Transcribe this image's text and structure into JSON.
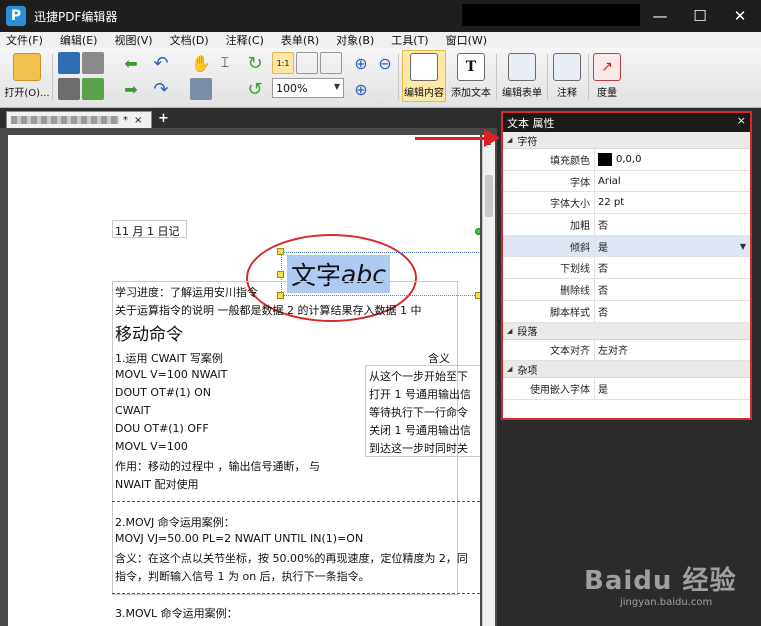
{
  "window": {
    "title": "迅捷PDF编辑器",
    "logo_text": "P",
    "controls": {
      "minimize": "—",
      "maximize": "☐",
      "close": "✕"
    }
  },
  "menu": [
    "文件(F)",
    "编辑(E)",
    "视图(V)",
    "文档(D)",
    "注释(C)",
    "表单(R)",
    "对象(B)",
    "工具(T)",
    "窗口(W)"
  ],
  "toolbar": {
    "open_label": "打开(O)...",
    "zoom_value": "100%",
    "edit_content_label": "编辑内容",
    "add_text_label": "添加文本",
    "edit_form_label": "编辑表单",
    "annotate_label": "注释",
    "measure_label": "度量",
    "actual_size_icon_text": "1:1"
  },
  "document_tab": {
    "modified_marker": "*",
    "close": "×",
    "new_tab": "+"
  },
  "page": {
    "date_label": "11 月 1  日记",
    "selected_text_cn": "文字",
    "selected_text_en": "abc",
    "lines": [
      "学习进度：了解运用安川指令",
      "关于运算指令的说明  一般都是数据 2  的计算结果存入数据 1 中",
      "移动命令",
      "1.运用 CWAIT  写案例",
      "含义",
      "MOVL V=100 NWAIT",
      "DOUT OT#(1) ON",
      "CWAIT",
      "DOU OT#(1) OFF",
      "MOVL V=100",
      "作用：移动的过程中 ，输出信号通断， 与",
      "NWAIT 配对使用",
      "从这个一步开始至下",
      "打开 1 号通用输出信",
      "等待执行下一行命令",
      "关闭 1 号通用输出信",
      "到达这一步时同时关",
      "2.MOVJ 命令运用案例：",
      "MOVJ    VJ=50.00    PL=2    NWAIT    UNTIL    IN(1)=ON",
      "含义：在这个点以关节坐标，按 50.00%的再现速度，定位精度为 2，同",
      "指令，判断输入信号 1 为 on 后，执行下一条指令。",
      "3.MOVL 命令运用案例："
    ]
  },
  "properties": {
    "title": "文本 属性",
    "close": "×",
    "categories": [
      {
        "name": "字符",
        "rows": [
          {
            "name": "填充颜色",
            "value": "0,0,0"
          },
          {
            "name": "字体",
            "value": "Arial"
          },
          {
            "name": "字体大小",
            "value": "22 pt"
          },
          {
            "name": "加粗",
            "value": "否"
          },
          {
            "name": "倾斜",
            "value": "是"
          },
          {
            "name": "下划线",
            "value": "否"
          },
          {
            "name": "删除线",
            "value": "否"
          },
          {
            "name": "脚本样式",
            "value": "否"
          }
        ]
      },
      {
        "name": "段落",
        "rows": [
          {
            "name": "文本对齐",
            "value": "左对齐"
          }
        ]
      },
      {
        "name": "杂项",
        "rows": [
          {
            "name": "使用嵌入字体",
            "value": "是"
          }
        ]
      }
    ],
    "fill_color_hex": "#000000"
  },
  "watermark": {
    "brand": "Baidu 经验",
    "url": "jingyan.baidu.com"
  }
}
